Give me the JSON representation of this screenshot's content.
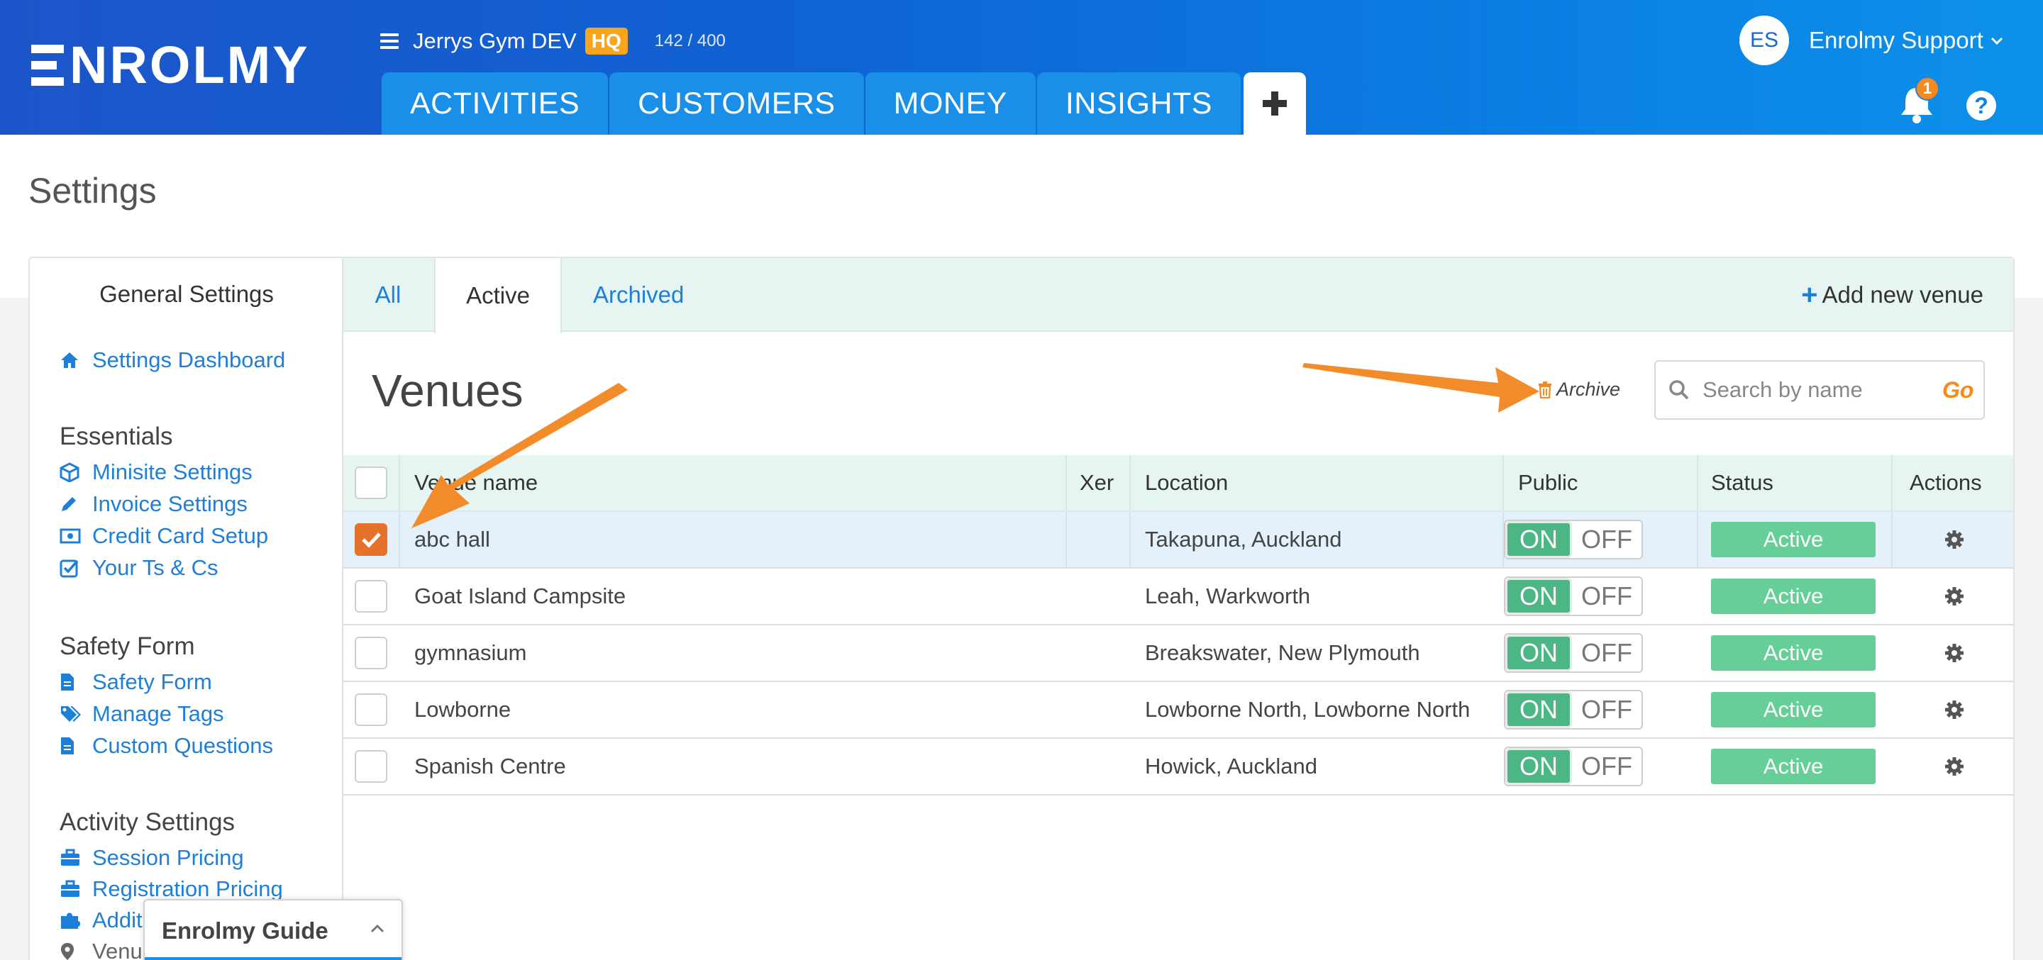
{
  "header": {
    "logo_text": "NROLMY",
    "org_name": "Jerrys Gym DEV",
    "org_badge": "HQ",
    "org_count": "142 / 400",
    "nav_tabs": [
      {
        "label": "ACTIVITIES"
      },
      {
        "label": "CUSTOMERS"
      },
      {
        "label": "MONEY"
      },
      {
        "label": "INSIGHTS"
      }
    ],
    "add_icon": "plus-icon",
    "user_initials": "ES",
    "user_name": "Enrolmy Support",
    "notification_count": "1",
    "help_label": "?"
  },
  "page": {
    "title": "Settings"
  },
  "sidebar": {
    "heading": "General Settings",
    "dashboard_label": "Settings Dashboard",
    "sections": [
      {
        "title": "Essentials",
        "items": [
          {
            "label": "Minisite Settings",
            "icon": "cube-icon"
          },
          {
            "label": "Invoice Settings",
            "icon": "pencil-icon"
          },
          {
            "label": "Credit Card Setup",
            "icon": "money-icon"
          },
          {
            "label": "Your Ts & Cs",
            "icon": "check-square-icon"
          }
        ]
      },
      {
        "title": "Safety Form",
        "items": [
          {
            "label": "Safety Form",
            "icon": "file-icon"
          },
          {
            "label": "Manage Tags",
            "icon": "tags-icon"
          },
          {
            "label": "Custom Questions",
            "icon": "file-icon"
          }
        ]
      },
      {
        "title": "Activity Settings",
        "items": [
          {
            "label": "Session Pricing",
            "icon": "briefcase-icon"
          },
          {
            "label": "Registration Pricing",
            "icon": "briefcase-icon"
          },
          {
            "label": "Additi",
            "icon": "puzzle-icon"
          },
          {
            "label": "Venu",
            "icon": "map-marker-icon"
          }
        ]
      }
    ]
  },
  "venues": {
    "tabs": [
      {
        "label": "All"
      },
      {
        "label": "Active"
      },
      {
        "label": "Archived"
      }
    ],
    "active_tab": "Active",
    "add_label": "Add new venue",
    "title": "Venues",
    "archive_label": "Archive",
    "search_placeholder": "Search by name",
    "search_go": "Go",
    "columns": {
      "name": "Venue name",
      "xer": "Xer",
      "location": "Location",
      "public": "Public",
      "status": "Status",
      "actions": "Actions"
    },
    "toggle_on": "ON",
    "toggle_off": "OFF",
    "rows": [
      {
        "name": "abc hall",
        "location": "Takapuna, Auckland",
        "status": "Active",
        "checked": true
      },
      {
        "name": "Goat Island Campsite",
        "location": "Leah, Warkworth",
        "status": "Active",
        "checked": false
      },
      {
        "name": "gymnasium",
        "location": "Breakswater, New Plymouth",
        "status": "Active",
        "checked": false
      },
      {
        "name": "Lowborne",
        "location": "Lowborne North, Lowborne North",
        "status": "Active",
        "checked": false
      },
      {
        "name": "Spanish Centre",
        "location": "Howick, Auckland",
        "status": "Active",
        "checked": false
      }
    ]
  },
  "guide": {
    "title": "Enrolmy Guide"
  },
  "colors": {
    "header_start": "#1c55c9",
    "header_end": "#0c91ea",
    "accent": "#1e7fd8",
    "orange": "#f58a1f",
    "status_green": "#65cf97",
    "toggle_green": "#4cb784"
  }
}
